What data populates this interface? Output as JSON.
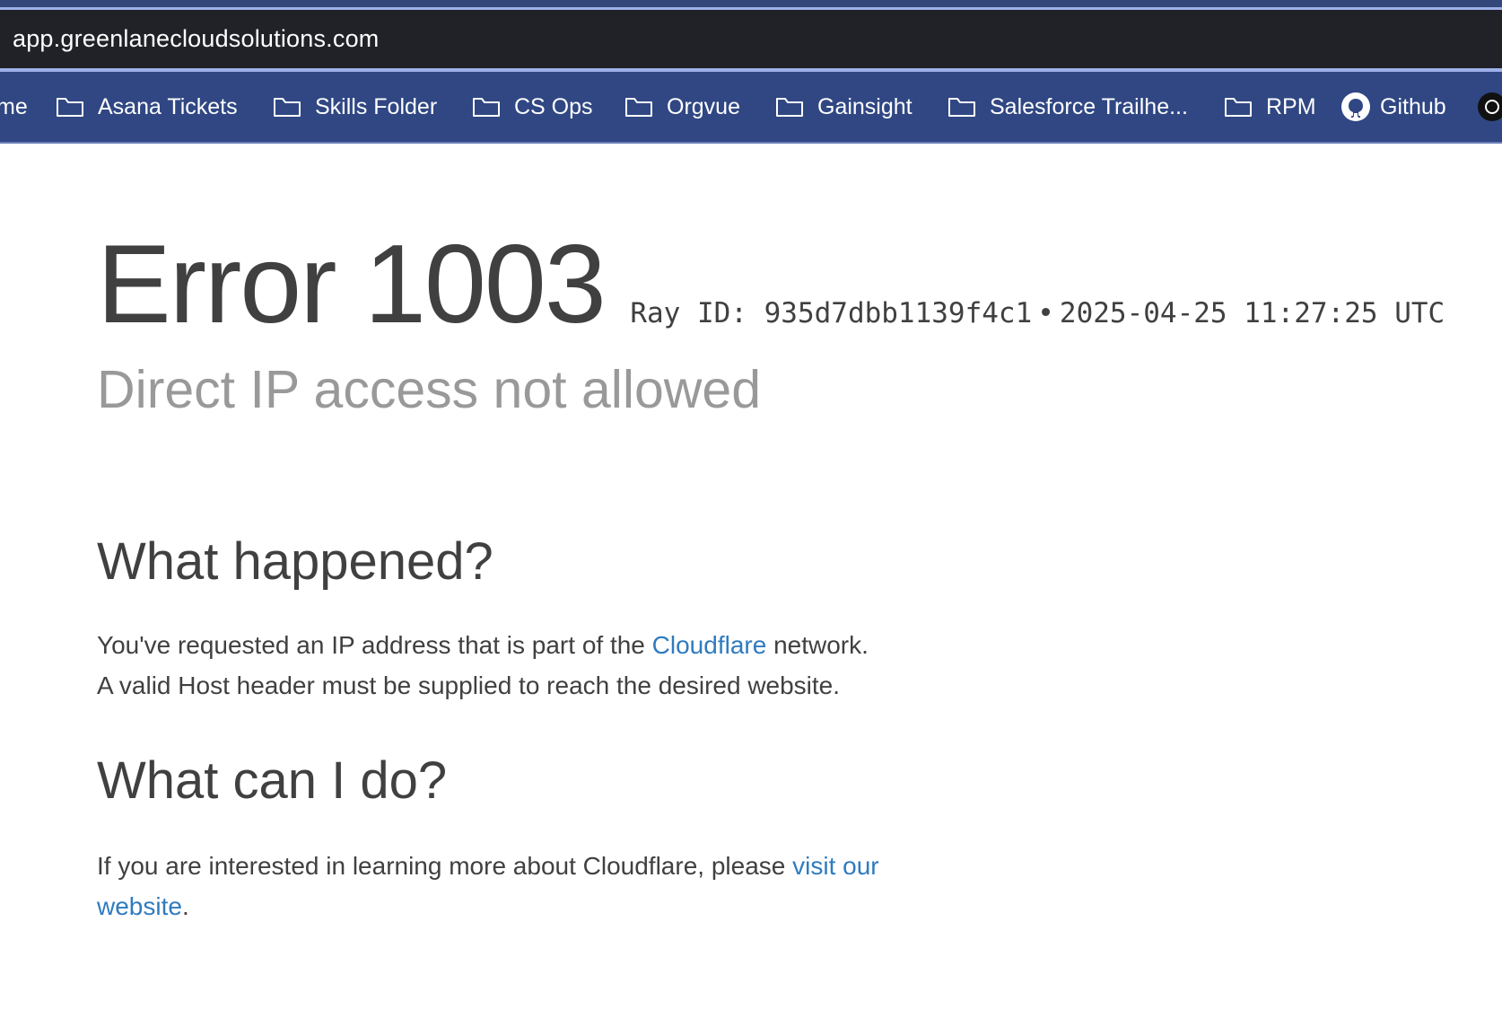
{
  "browser": {
    "url": "app.greenlanecloudsolutions.com"
  },
  "bookmarks": [
    {
      "label": "me",
      "icon": "none"
    },
    {
      "label": "Asana Tickets",
      "icon": "folder-icon"
    },
    {
      "label": "Skills Folder",
      "icon": "folder-icon"
    },
    {
      "label": "CS Ops",
      "icon": "folder-icon"
    },
    {
      "label": "Orgvue",
      "icon": "folder-icon"
    },
    {
      "label": "Gainsight",
      "icon": "folder-icon"
    },
    {
      "label": "Salesforce Trailhe...",
      "icon": "folder-icon"
    },
    {
      "label": "RPM",
      "icon": "folder-icon"
    },
    {
      "label": "Github",
      "icon": "github-icon"
    }
  ],
  "page": {
    "error_title": "Error 1003",
    "ray_id": "Ray ID: 935d7dbb1139f4c1",
    "bullet": "•",
    "timestamp": "2025-04-25 11:27:25 UTC",
    "subtitle": "Direct IP access not allowed",
    "what_happened": {
      "heading": "What happened?",
      "line1_prefix": "You've requested an IP address that is part of the ",
      "line1_link": "Cloudflare",
      "line1_suffix": " network.",
      "line2": "A valid Host header must be supplied to reach the desired website."
    },
    "what_can_i_do": {
      "heading": "What can I do?",
      "line1_prefix": "If you are interested in learning more about Cloudflare, please ",
      "line1_link": "visit our",
      "line2_link": "website",
      "line2_suffix": "."
    }
  },
  "colors": {
    "bookmark_bar": "#304783",
    "address_bar": "#212227",
    "link": "#2f7bbf",
    "text": "#404040",
    "subtitle": "#999999"
  }
}
